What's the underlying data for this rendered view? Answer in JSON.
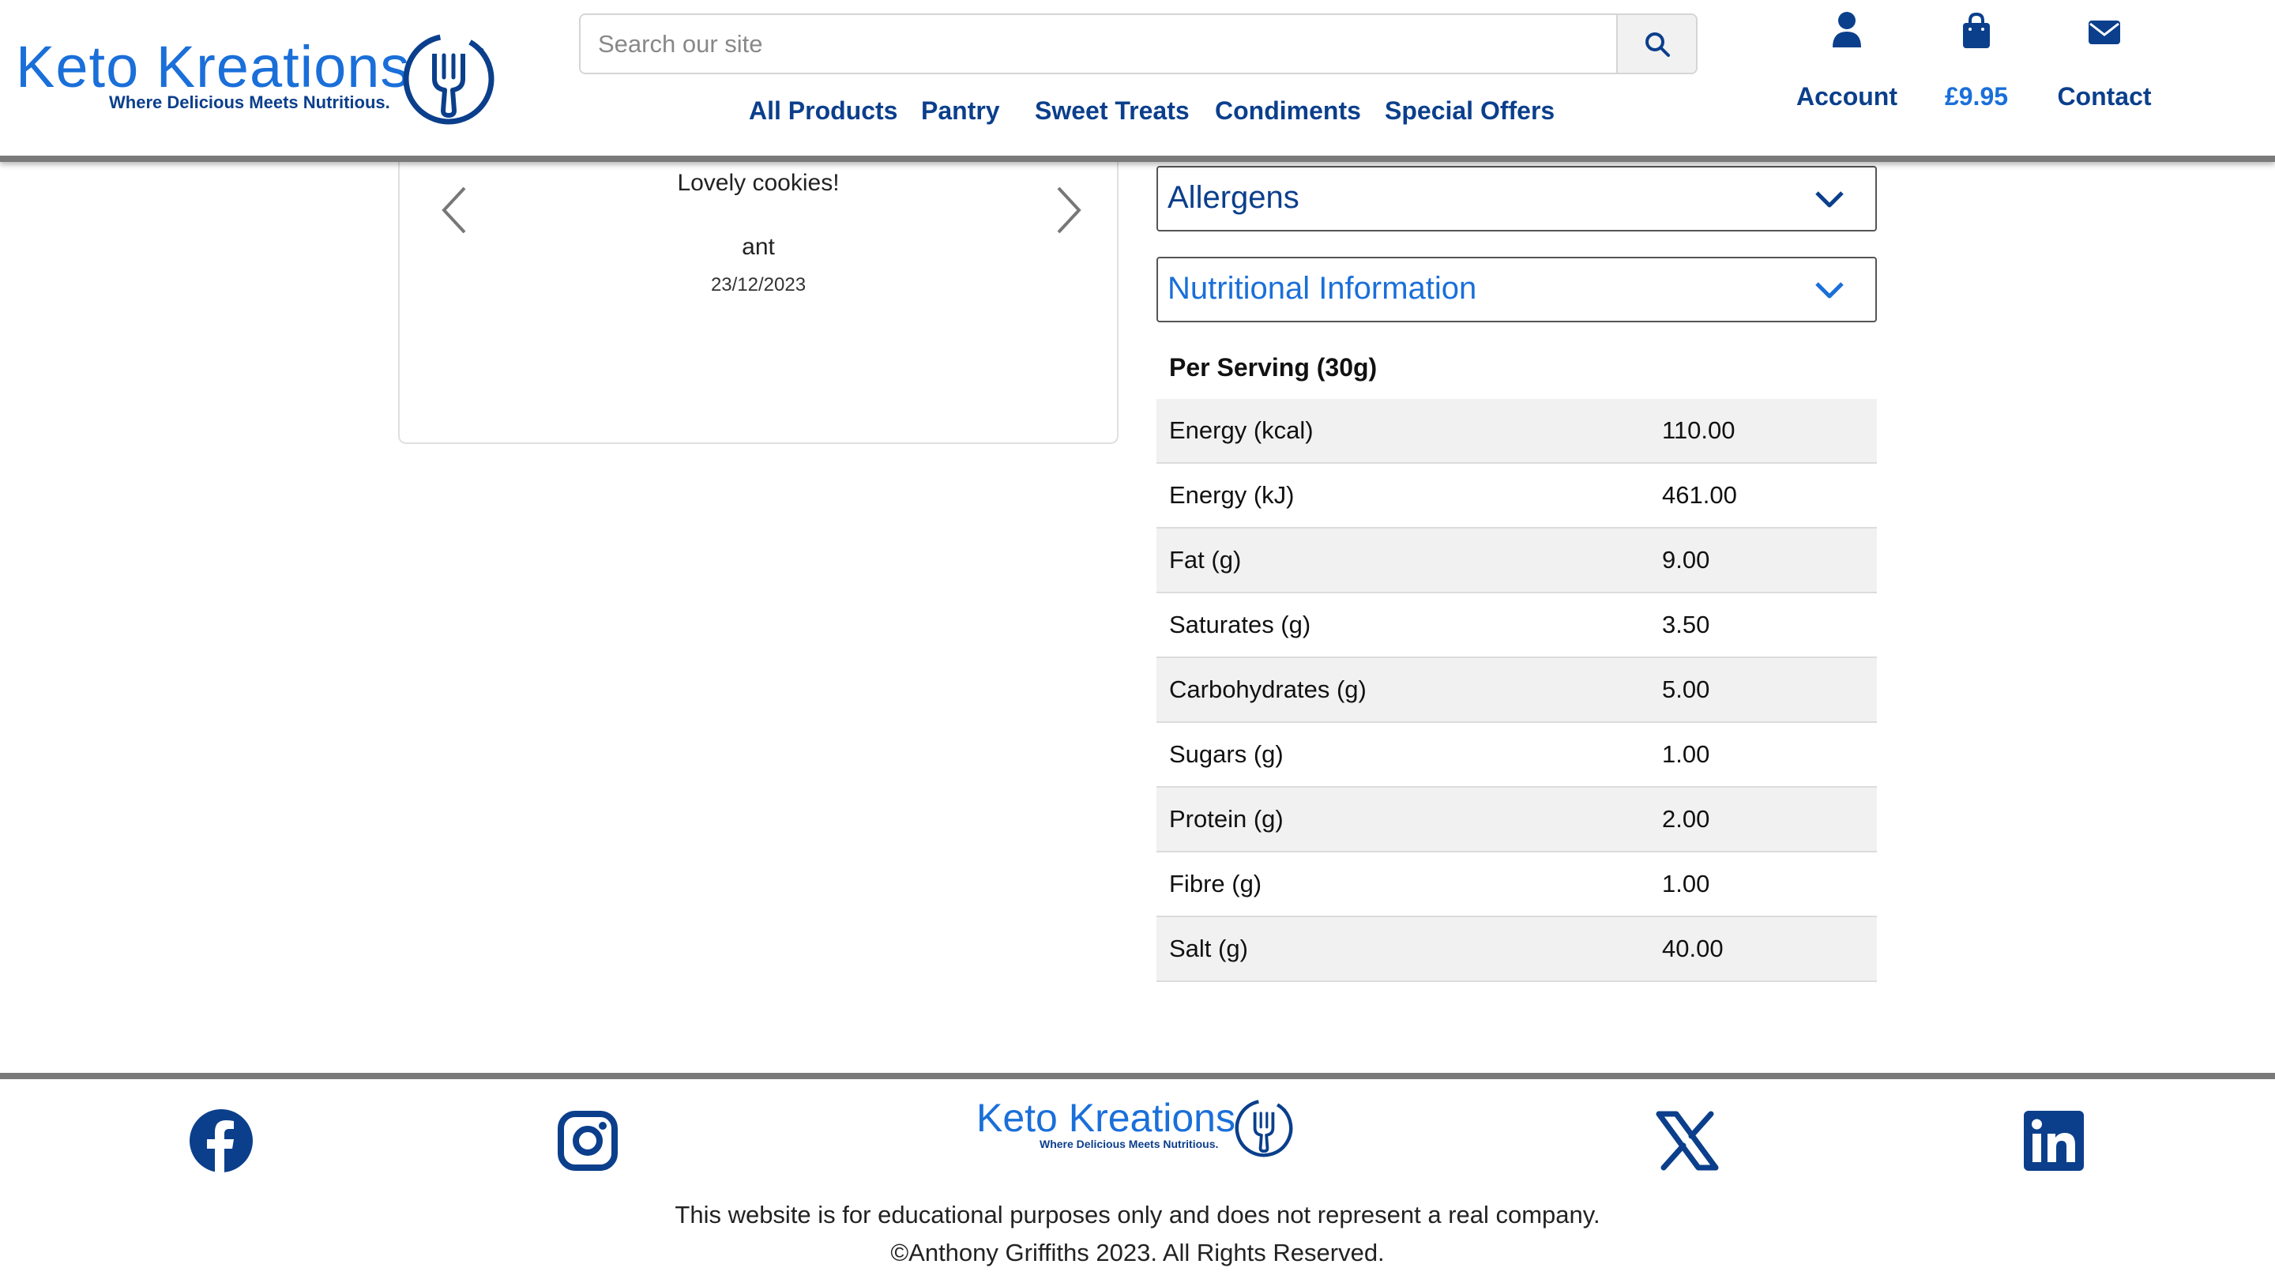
{
  "brand": {
    "name": "Keto Kreations",
    "tagline": "Where Delicious Meets Nutritious."
  },
  "search": {
    "placeholder": "Search our site",
    "icon": "search-icon"
  },
  "nav": {
    "items": [
      {
        "label": "All Products"
      },
      {
        "label": "Pantry"
      },
      {
        "label": "Sweet Treats"
      },
      {
        "label": "Condiments"
      },
      {
        "label": "Special Offers"
      }
    ]
  },
  "header_actions": {
    "account": {
      "label": "Account",
      "icon": "user-icon"
    },
    "basket": {
      "label": "£9.95",
      "icon": "shopping-bag-icon"
    },
    "contact": {
      "label": "Contact",
      "icon": "envelope-icon"
    }
  },
  "review": {
    "quote": "Lovely cookies!",
    "author": "ant",
    "date": "23/12/2023"
  },
  "accordions": {
    "allergens": {
      "title": "Allergens",
      "expanded": false
    },
    "nutrition": {
      "title": "Nutritional Information",
      "expanded": true
    }
  },
  "nutrition": {
    "header": "Per Serving (30g)",
    "rows": [
      {
        "label": "Energy (kcal)",
        "value": "110.00"
      },
      {
        "label": "Energy (kJ)",
        "value": "461.00"
      },
      {
        "label": "Fat (g)",
        "value": "9.00"
      },
      {
        "label": "Saturates (g)",
        "value": "3.50"
      },
      {
        "label": "Carbohydrates (g)",
        "value": "5.00"
      },
      {
        "label": "Sugars (g)",
        "value": "1.00"
      },
      {
        "label": "Protein (g)",
        "value": "2.00"
      },
      {
        "label": "Fibre (g)",
        "value": "1.00"
      },
      {
        "label": "Salt (g)",
        "value": "40.00"
      }
    ]
  },
  "footer": {
    "social": [
      "facebook-icon",
      "instagram-icon",
      "x-icon",
      "linkedin-icon"
    ],
    "disclaimer": "This website is for educational purposes only and does not represent a real company.",
    "copyright": "©Anthony Griffiths 2023. All Rights Reserved."
  },
  "colors": {
    "brand_blue": "#1a6fd9",
    "navy": "#0b3f8c",
    "row_shade": "#f1f1f1"
  }
}
